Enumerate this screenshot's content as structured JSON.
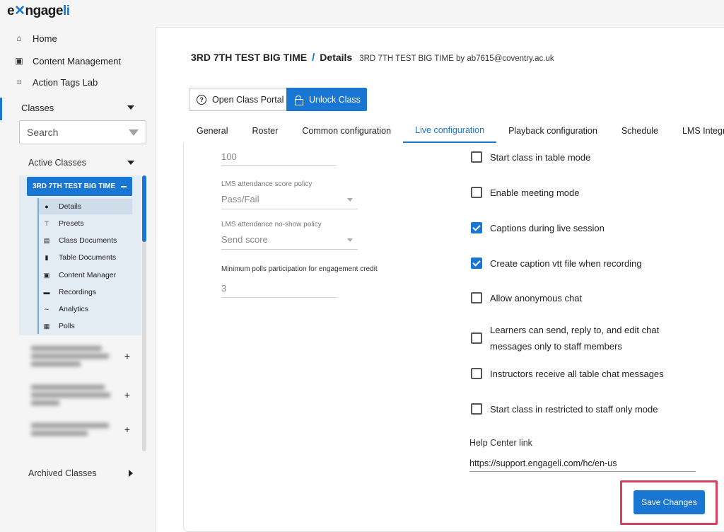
{
  "app": {
    "logo_prefix": "e",
    "logo_mid": "ngage",
    "logo_suffix": "li"
  },
  "sidebar": {
    "nav": [
      {
        "label": "Home",
        "icon": "home-icon"
      },
      {
        "label": "Content Management",
        "icon": "content-icon"
      },
      {
        "label": "Action Tags Lab",
        "icon": "tags-icon"
      }
    ],
    "classes_label": "Classes",
    "search_placeholder": "Search",
    "active_classes_label": "Active Classes",
    "selected_class": "3RD 7TH TEST BIG TIME",
    "class_items": [
      {
        "label": "Details",
        "icon": "info-icon"
      },
      {
        "label": "Presets",
        "icon": "presets-icon"
      },
      {
        "label": "Class Documents",
        "icon": "documents-icon"
      },
      {
        "label": "Table Documents",
        "icon": "document-icon"
      },
      {
        "label": "Content Manager",
        "icon": "content-icon"
      },
      {
        "label": "Recordings",
        "icon": "recordings-icon"
      },
      {
        "label": "Analytics",
        "icon": "analytics-icon"
      },
      {
        "label": "Polls",
        "icon": "polls-icon"
      }
    ],
    "plus_symbol": "+",
    "archived_label": "Archived Classes"
  },
  "header": {
    "course": "3RD 7TH TEST BIG TIME",
    "separator": "/",
    "page": "Details",
    "subtitle": "3RD 7TH TEST BIG TIME by ab7615@coventry.ac.uk"
  },
  "actions": {
    "portal_label": "Open Class Portal",
    "unlock_label": "Unlock Class"
  },
  "tabs": [
    "General",
    "Roster",
    "Common configuration",
    "Live configuration",
    "Playback configuration",
    "Schedule",
    "LMS Integration"
  ],
  "active_tab": "Live configuration",
  "left_fields": {
    "top_value": "100",
    "attendance_policy_label": "LMS attendance score policy",
    "attendance_policy_value": "Pass/Fail",
    "noshow_policy_label": "LMS attendance no-show policy",
    "noshow_policy_value": "Send score",
    "polls_label": "Minimum polls participation for engagement credit",
    "polls_value": "3"
  },
  "checkboxes": [
    {
      "label": "Start class in table mode",
      "checked": false
    },
    {
      "label": "Enable meeting mode",
      "checked": false
    },
    {
      "label": "Captions during live session",
      "checked": true
    },
    {
      "label": "Create caption vtt file when recording",
      "checked": true
    },
    {
      "label": "Allow anonymous chat",
      "checked": false
    },
    {
      "label_line1": "Learners can send, reply to, and edit chat",
      "label_line2": "messages only to staff members",
      "checked": false
    },
    {
      "label": "Instructors receive all table chat messages",
      "checked": false
    },
    {
      "label": "Start class in restricted to staff only mode",
      "checked": false
    }
  ],
  "help_center": {
    "label": "Help Center link",
    "value": "https://support.engageli.com/hc/en-us"
  },
  "save_label": "Save Changes",
  "colors": {
    "accent": "#1976d2",
    "highlight": "#d9405e"
  }
}
